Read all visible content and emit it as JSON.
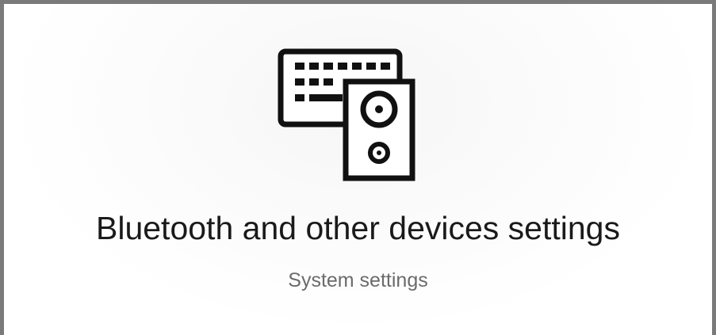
{
  "result": {
    "icon": "keyboard-speaker-icon",
    "title": "Bluetooth and other devices settings",
    "subtitle": "System settings"
  }
}
